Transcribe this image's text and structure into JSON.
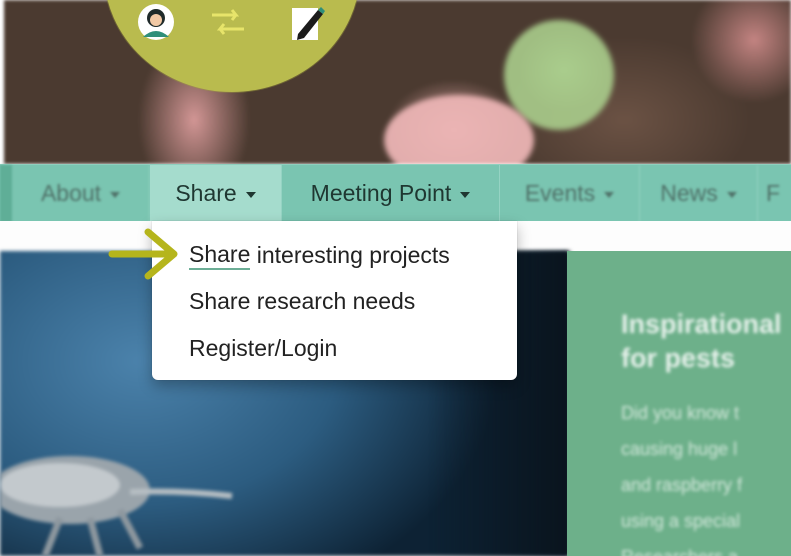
{
  "logo": {
    "icons": [
      "person-icon",
      "exchange-arrows-icon",
      "pen-document-icon"
    ],
    "circle_color": "#b9bb4e"
  },
  "navbar": {
    "items": [
      {
        "label": "About",
        "blurred": true
      },
      {
        "label": "Share",
        "blurred": false,
        "active": true
      },
      {
        "label": "Meeting Point",
        "blurred": false
      },
      {
        "label": "Events",
        "blurred": true
      },
      {
        "label": "News",
        "blurred": true
      },
      {
        "label": "F",
        "blurred": true
      }
    ],
    "bg_color": "#7ac5b1",
    "active_bg_color": "#a5dccd"
  },
  "dropdown": {
    "items": [
      {
        "label_highlight": "Share",
        "label_rest": " interesting projects"
      },
      {
        "label": "Share research needs"
      },
      {
        "label": "Register/Login"
      }
    ]
  },
  "feature": {
    "title_line1": "Inspirational",
    "title_line2": "for pests",
    "body_lines": [
      "Did you know t",
      "causing huge l",
      "and raspberry f",
      "using a special",
      "Researchers a"
    ],
    "bg_color": "#6db08a"
  },
  "annotation": {
    "arrow_color": "#b5b51c"
  }
}
